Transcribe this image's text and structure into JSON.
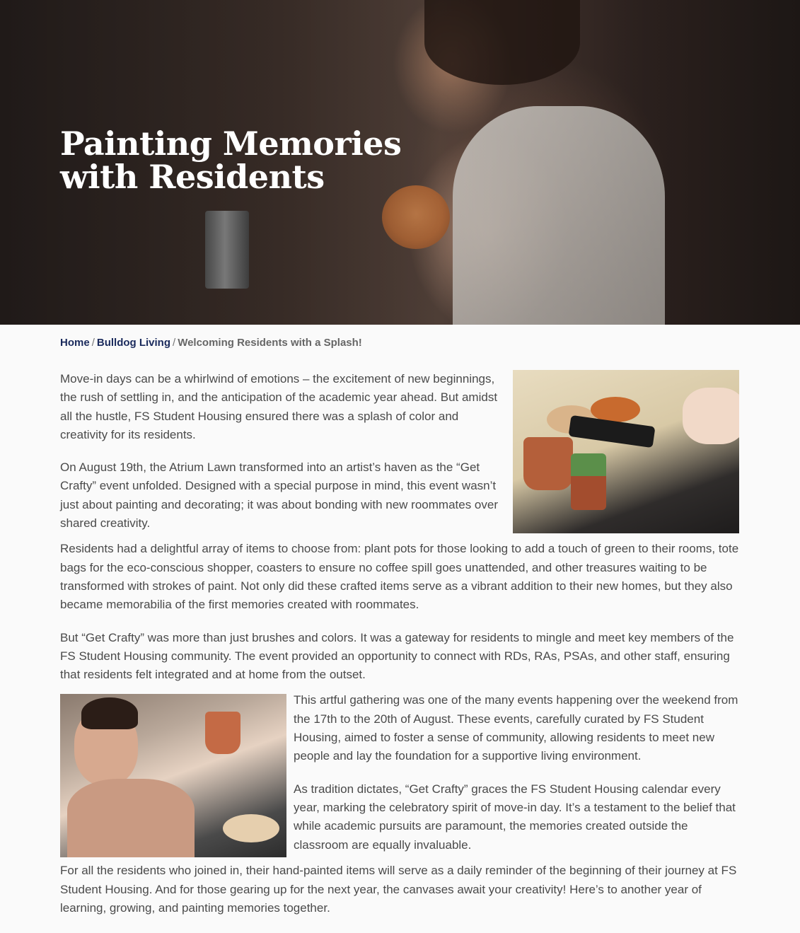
{
  "hero": {
    "title_line1": "Painting Memories",
    "title_line2": "with Residents"
  },
  "breadcrumb": {
    "home": "Home",
    "separator": "/",
    "section": "Bulldog Living",
    "current": "Welcoming Residents with a Splash!"
  },
  "article": {
    "paragraphs": [
      "Move-in days can be a whirlwind of emotions – the excitement of new beginnings, the rush of settling in, and the anticipation of the academic year ahead. But amidst all the hustle, FS Student Housing ensured there was a splash of color and creativity for its residents.",
      "On August 19th, the Atrium Lawn transformed into an artist’s haven as the “Get Crafty” event unfolded. Designed with a special purpose in mind, this event wasn’t just about painting and decorating; it was about bonding with new roommates over shared creativity.",
      "Residents had a delightful array of items to choose from: plant pots for those looking to add a touch of green to their rooms, tote bags for the eco-conscious shopper, coasters to ensure no coffee spill goes unattended, and other treasures waiting to be transformed with strokes of paint. Not only did these crafted items serve as a vibrant addition to their new homes, but they also became memorabilia of the first memories created with roommates.",
      "But “Get Crafty” was more than just brushes and colors. It was a gateway for residents to mingle and meet key members of the FS Student Housing community. The event provided an opportunity to connect with RDs, RAs, PSAs, and other staff, ensuring that residents felt integrated and at home from the outset.",
      "This artful gathering was one of the many events happening over the weekend from the 17th to the 20th of August. These events, carefully curated by FS Student Housing, aimed to foster a sense of community, allowing residents to meet new people and lay the foundation for a supportive living environment.",
      "As tradition dictates, “Get Crafty” graces the FS Student Housing calendar every year, marking the celebratory spirit of move-in day. It’s a testament to the belief that while academic pursuits are paramount, the memories created outside the classroom are equally invaluable.",
      "For all the residents who joined in, their hand-painted items will serve as a daily reminder of the beginning of their journey at FS Student Housing. And for those gearing up for the next year, the canvases await your creativity! Here’s to another year of learning, growing, and painting memories together."
    ]
  },
  "colors": {
    "link": "#1a2a5c",
    "body_text": "#4a4a4a",
    "background": "#fafafa",
    "hero_title": "#ffffff"
  }
}
